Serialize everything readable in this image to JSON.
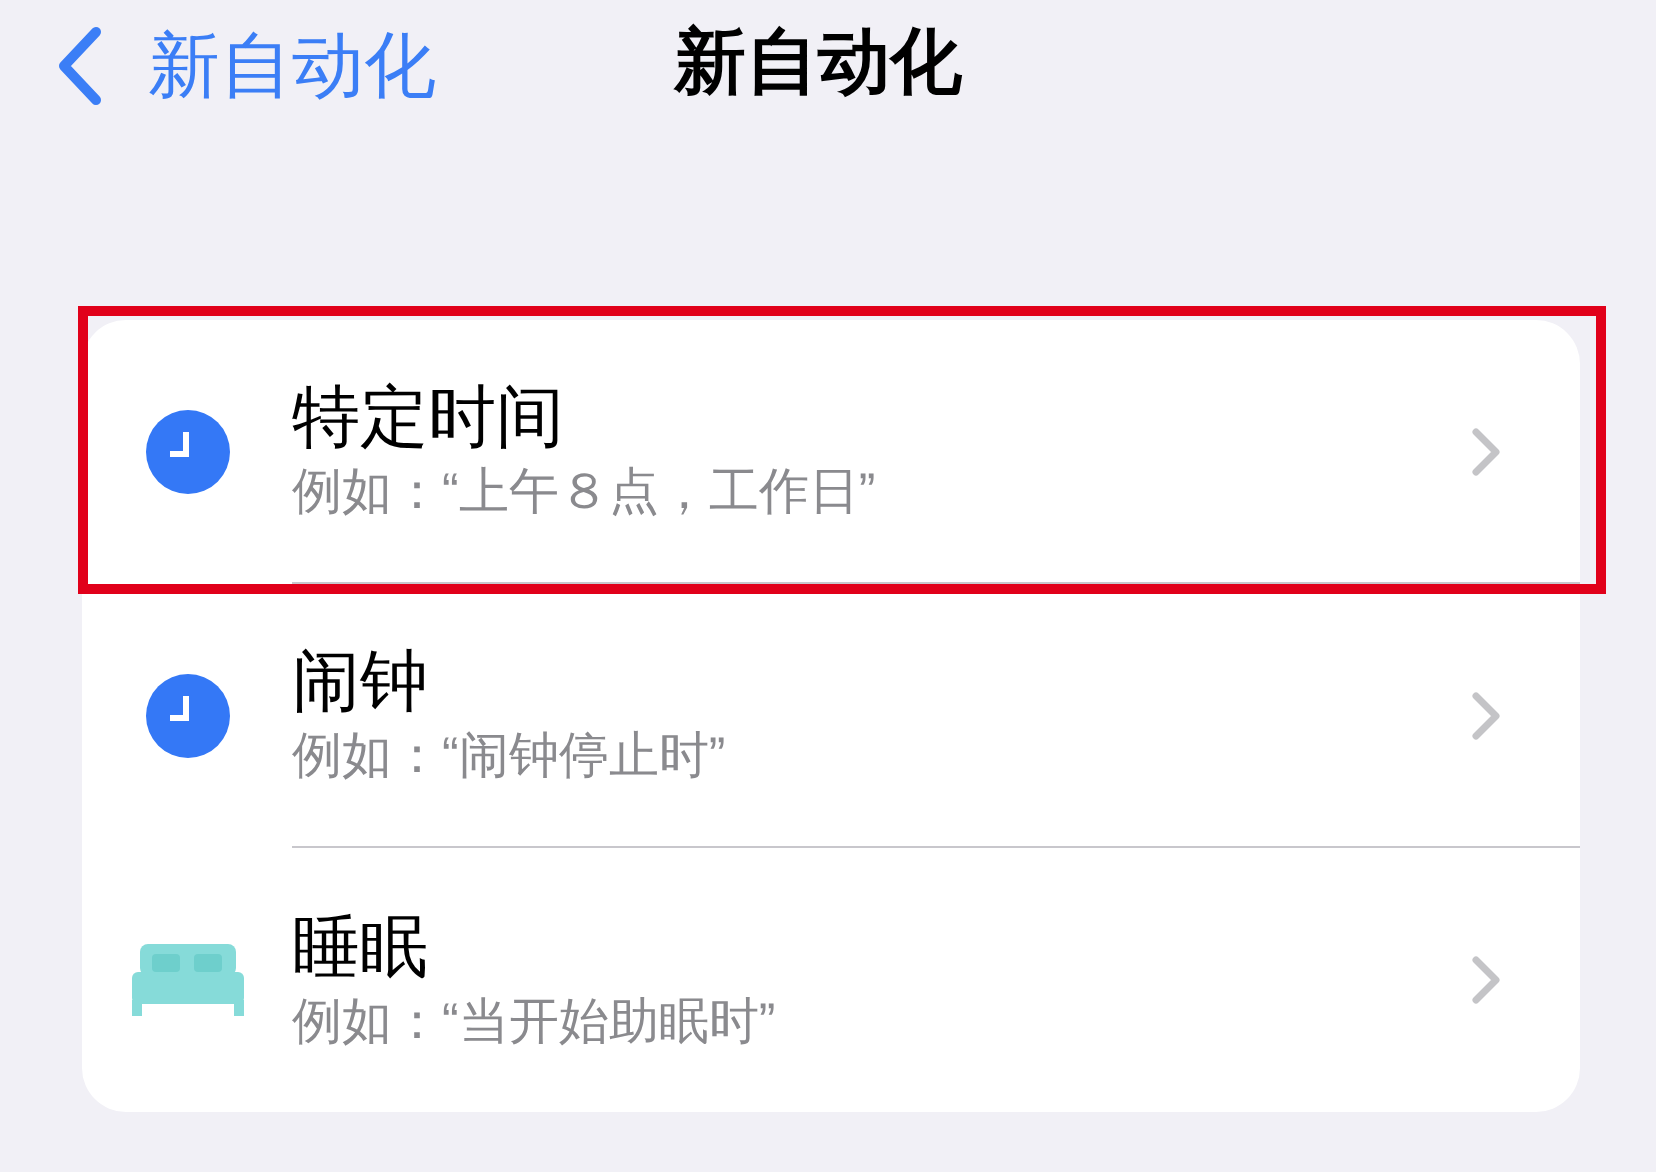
{
  "nav": {
    "back_label": "新自动化",
    "title": "新自动化"
  },
  "rows": [
    {
      "kind": "clock",
      "title": "特定时间",
      "subtitle": "例如：“上午８点，工作日”",
      "highlighted": true
    },
    {
      "kind": "clock",
      "title": "闹钟",
      "subtitle": "例如：“闹钟停止时”",
      "highlighted": false
    },
    {
      "kind": "bed",
      "title": "睡眠",
      "subtitle": "例如：“当开始助眠时”",
      "highlighted": false
    }
  ]
}
